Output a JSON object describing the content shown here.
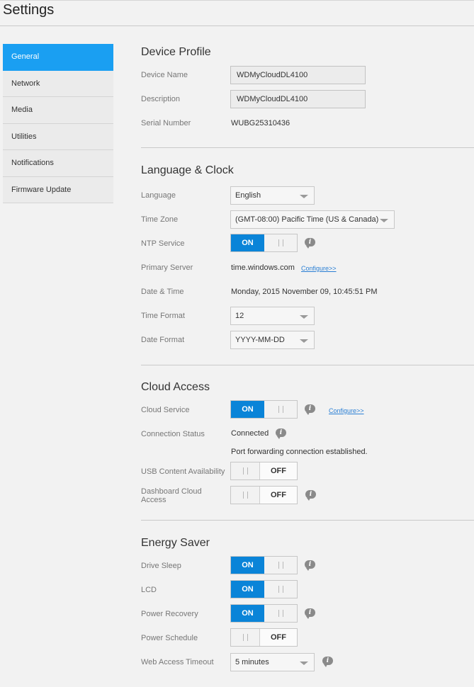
{
  "header": {
    "title": "Settings"
  },
  "sidebar": {
    "items": [
      {
        "label": "General",
        "active": true
      },
      {
        "label": "Network"
      },
      {
        "label": "Media"
      },
      {
        "label": "Utilities"
      },
      {
        "label": "Notifications"
      },
      {
        "label": "Firmware Update"
      }
    ]
  },
  "device_profile": {
    "title": "Device Profile",
    "device_name_label": "Device Name",
    "device_name_value": "WDMyCloudDL4100",
    "description_label": "Description",
    "description_value": "WDMyCloudDL4100",
    "serial_label": "Serial Number",
    "serial_value": "WUBG25310436"
  },
  "language_clock": {
    "title": "Language & Clock",
    "language_label": "Language",
    "language_value": "English",
    "timezone_label": "Time Zone",
    "timezone_value": "(GMT-08:00) Pacific Time (US & Canada)",
    "ntp_label": "NTP Service",
    "ntp_state": "ON",
    "primary_server_label": "Primary Server",
    "primary_server_value": "time.windows.com",
    "configure_link": "Configure>>",
    "datetime_label": "Date & Time",
    "datetime_value": "Monday, 2015 November 09, 10:45:51 PM",
    "time_format_label": "Time Format",
    "time_format_value": "12",
    "date_format_label": "Date Format",
    "date_format_value": "YYYY-MM-DD"
  },
  "cloud_access": {
    "title": "Cloud Access",
    "cloud_service_label": "Cloud Service",
    "cloud_service_state": "ON",
    "configure_link": "Configure>>",
    "connection_status_label": "Connection Status",
    "connection_status_value": "Connected",
    "port_forwarding_value": "Port forwarding connection established.",
    "usb_label": "USB Content Availability",
    "usb_state": "OFF",
    "dashboard_label": "Dashboard Cloud Access",
    "dashboard_state": "OFF"
  },
  "energy_saver": {
    "title": "Energy Saver",
    "drive_sleep_label": "Drive Sleep",
    "drive_sleep_state": "ON",
    "lcd_label": "LCD",
    "lcd_state": "ON",
    "power_recovery_label": "Power Recovery",
    "power_recovery_state": "ON",
    "power_schedule_label": "Power Schedule",
    "power_schedule_state": "OFF",
    "web_timeout_label": "Web Access Timeout",
    "web_timeout_value": "5 minutes"
  },
  "icons": {
    "info": "info-bubble-icon",
    "dropdown": "chevron-down-icon",
    "toggle_grip": "grip-icon"
  },
  "colors": {
    "accent": "#1a9ff2",
    "toggle_on": "#0a84d8",
    "link": "#2a7fd4"
  }
}
